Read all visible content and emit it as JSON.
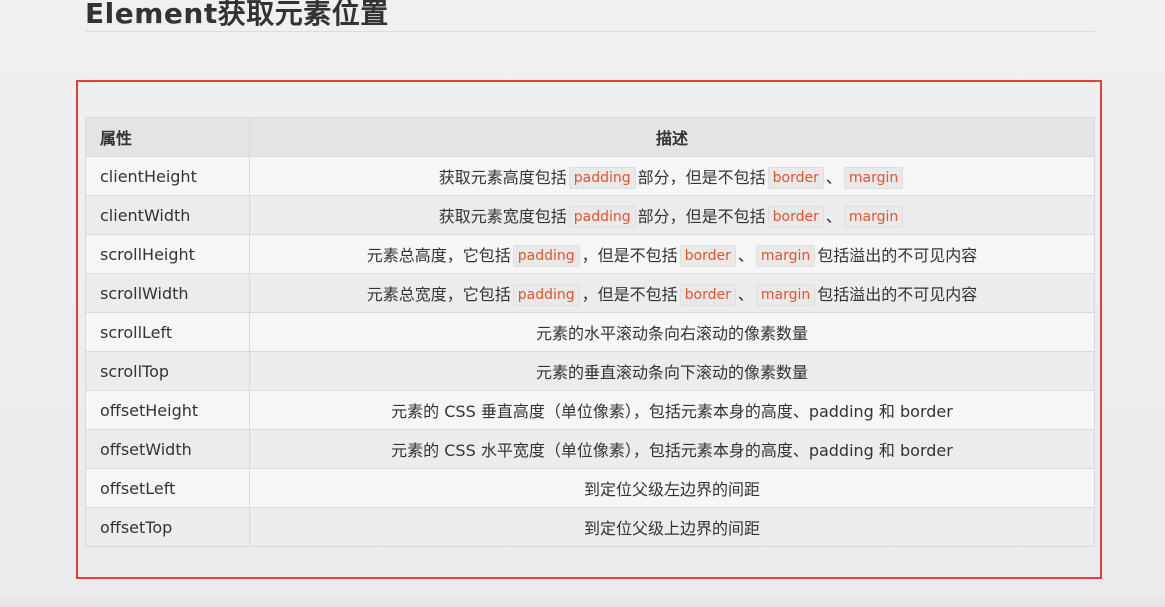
{
  "page_title": "Element获取元素位置",
  "table": {
    "headers": [
      "属性",
      "描述"
    ],
    "rows": [
      {
        "property": "clientHeight",
        "desc": [
          {
            "t": "text",
            "v": "获取元素高度包括"
          },
          {
            "t": "code",
            "v": "padding"
          },
          {
            "t": "text",
            "v": "部分，但是不包括"
          },
          {
            "t": "code",
            "v": "border"
          },
          {
            "t": "text",
            "v": "、"
          },
          {
            "t": "code",
            "v": "margin"
          }
        ]
      },
      {
        "property": "clientWidth",
        "desc": [
          {
            "t": "text",
            "v": "获取元素宽度包括"
          },
          {
            "t": "code",
            "v": "padding"
          },
          {
            "t": "text",
            "v": "部分，但是不包括"
          },
          {
            "t": "code",
            "v": "border"
          },
          {
            "t": "text",
            "v": "、"
          },
          {
            "t": "code",
            "v": "margin"
          }
        ]
      },
      {
        "property": "scrollHeight",
        "desc": [
          {
            "t": "text",
            "v": "元素总高度，它包括"
          },
          {
            "t": "code",
            "v": "padding"
          },
          {
            "t": "text",
            "v": "，但是不包括"
          },
          {
            "t": "code",
            "v": "border"
          },
          {
            "t": "text",
            "v": "、"
          },
          {
            "t": "code",
            "v": "margin"
          },
          {
            "t": "text",
            "v": "包括溢出的不可见内容"
          }
        ]
      },
      {
        "property": "scrollWidth",
        "desc": [
          {
            "t": "text",
            "v": "元素总宽度，它包括"
          },
          {
            "t": "code",
            "v": "padding"
          },
          {
            "t": "text",
            "v": "，但是不包括"
          },
          {
            "t": "code",
            "v": "border"
          },
          {
            "t": "text",
            "v": "、"
          },
          {
            "t": "code",
            "v": "margin"
          },
          {
            "t": "text",
            "v": "包括溢出的不可见内容"
          }
        ]
      },
      {
        "property": "scrollLeft",
        "desc": [
          {
            "t": "text",
            "v": "元素的水平滚动条向右滚动的像素数量"
          }
        ]
      },
      {
        "property": "scrollTop",
        "desc": [
          {
            "t": "text",
            "v": "元素的垂直滚动条向下滚动的像素数量"
          }
        ]
      },
      {
        "property": "offsetHeight",
        "desc": [
          {
            "t": "text",
            "v": "元素的 CSS 垂直高度（单位像素），包括元素本身的高度、padding 和 border"
          }
        ]
      },
      {
        "property": "offsetWidth",
        "desc": [
          {
            "t": "text",
            "v": "元素的 CSS 水平宽度（单位像素），包括元素本身的高度、padding 和 border"
          }
        ]
      },
      {
        "property": "offsetLeft",
        "desc": [
          {
            "t": "text",
            "v": "到定位父级左边界的间距"
          }
        ]
      },
      {
        "property": "offsetTop",
        "desc": [
          {
            "t": "text",
            "v": "到定位父级上边界的间距"
          }
        ]
      }
    ]
  },
  "colors": {
    "highlight_border": "#e2403a",
    "code_text": "#e1552f",
    "header_bg": "#e4e4e4"
  }
}
